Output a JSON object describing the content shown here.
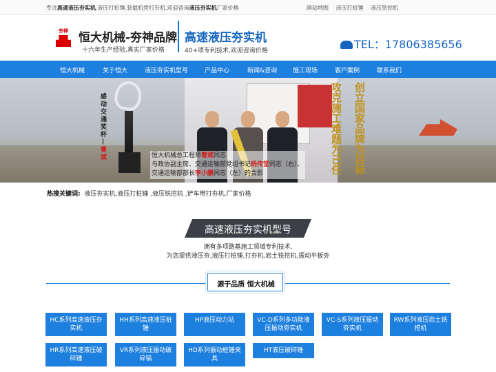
{
  "topbar": {
    "intro_prefix": "专注",
    "intro_bold1": "高速液压夯实机",
    "intro_mid": ",液压打桩锤,装载机旁打夯机,欢迎咨询",
    "intro_bold2": "液压夯实机",
    "intro_suffix": "厂家价格",
    "links": [
      "网站地图",
      "液压打桩锤",
      "液压铣挖机"
    ]
  },
  "header": {
    "logo_text": "夯神",
    "brand_title": "恒大机械-夯神品牌",
    "brand_sub": "十六年生产经验,真实厂家价格",
    "slogan_title": "高速液压夯实机",
    "slogan_sub": "40+项专利技术,欢迎咨询价格",
    "phone_label": "TEL：",
    "phone_number": "17806385656"
  },
  "nav": [
    "恒大机械",
    "关于恒大",
    "液压夯实机型号",
    "产品中心",
    "新闻&咨询",
    "施工现场",
    "客户案例",
    "联系我们"
  ],
  "banner": {
    "award_a": "感动交通奖杯—",
    "award_b": "曹斌",
    "caption1_a": "恒大机械总工程师",
    "caption1_b": "曹斌",
    "caption1_c": "同志",
    "caption2_a": "与政协副主席、交通运输部党组书记",
    "caption2_b": "杨传堂",
    "caption2_c": "同志（右）、",
    "caption3_a": "交通运输部部长",
    "caption3_b": "李小鹏",
    "caption3_c": "同志（左）的合影",
    "vertical_left": "攻克施工难题为己任",
    "vertical_right": "创立国家品牌为目标"
  },
  "hot": {
    "label": "热搜关键词:",
    "text": "液压夯实机,液压打桩锤 ,液压铣挖机 ,铲车带打夯机,厂家价格"
  },
  "section": {
    "title": "高速液压夯实机型号",
    "desc1": "拥有多项路基施工领域专利技术,",
    "desc2": "为您提供液压夯,液压打桩锤,打夯机,岩土铣挖机,振动平板夯",
    "tag": "源于品质  恒大机械"
  },
  "categories": [
    "HC系列高速液压夯实机",
    "HH系列高速液压桩锤",
    "HP液压动力站",
    "VC-D系列多功能液压振动夯实机",
    "VC-S系列液压振动夯实机",
    "RW系列液压岩土铣挖机",
    "HR系列高速液压破碎锤",
    "VR系列液压振动破碎镐",
    "HD系列振动桩锤夹具",
    "HT液压破碎锤"
  ]
}
